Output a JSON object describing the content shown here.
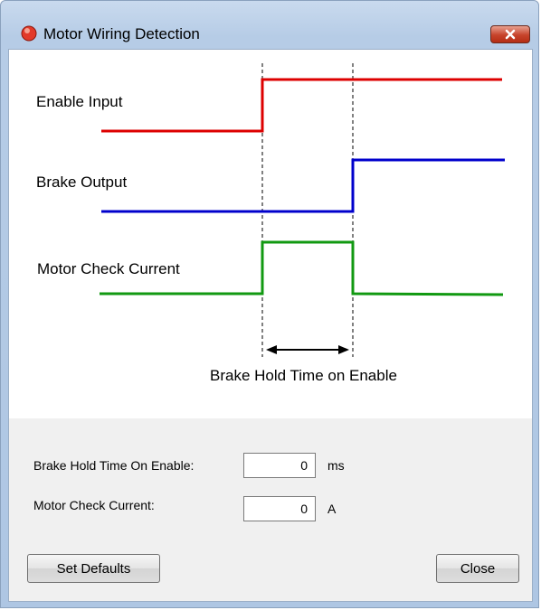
{
  "window": {
    "title": "Motor Wiring Detection",
    "icon": "red-circle-app-icon",
    "close_icon": "close-x-icon"
  },
  "diagram": {
    "signals": [
      {
        "label": "Enable Input",
        "color": "#dd0000"
      },
      {
        "label": "Brake Output",
        "color": "#0000cc"
      },
      {
        "label": "Motor Check Current",
        "color": "#119911"
      }
    ],
    "interval_label": "Brake Hold Time on Enable"
  },
  "form": {
    "brake_hold": {
      "label": "Brake Hold Time On Enable:",
      "value": "0",
      "unit": "ms"
    },
    "motor_current": {
      "label": "Motor Check Current:",
      "value": "0",
      "unit": "A"
    }
  },
  "buttons": {
    "set_defaults": "Set Defaults",
    "close": "Close"
  }
}
